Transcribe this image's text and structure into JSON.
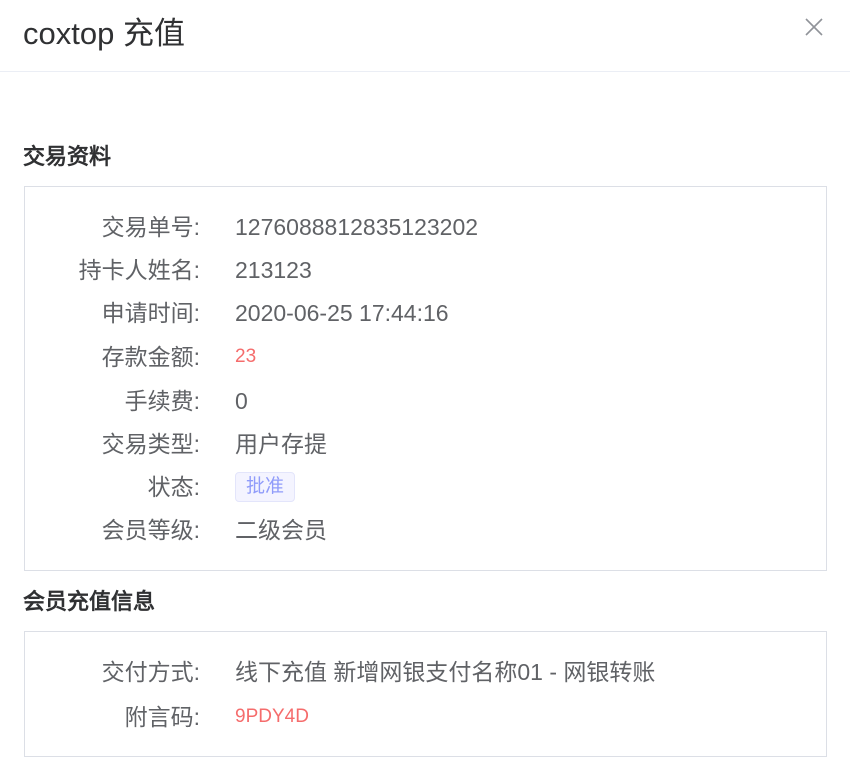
{
  "dialog": {
    "title": "coxtop 充值",
    "close_icon": "close-icon"
  },
  "transaction": {
    "section_title": "交易资料",
    "rows": [
      {
        "label": "交易单号:",
        "value": "1276088812835123202"
      },
      {
        "label": "持卡人姓名:",
        "value": "213123"
      },
      {
        "label": "申请时间:",
        "value": "2020-06-25 17:44:16"
      },
      {
        "label": "存款金额:",
        "value": "23"
      },
      {
        "label": "手续费:",
        "value": "0"
      },
      {
        "label": "交易类型:",
        "value": "用户存提"
      },
      {
        "label": "状态:",
        "value": "批准"
      },
      {
        "label": "会员等级:",
        "value": "二级会员"
      }
    ]
  },
  "member_recharge": {
    "section_title": "会员充值信息",
    "rows": [
      {
        "label": "交付方式:",
        "value": "线下充值 新增网银支付名称01 - 网银转账"
      },
      {
        "label": "附言码:",
        "value": "9PDY4D"
      }
    ]
  },
  "colors": {
    "amount": "#f56c6c",
    "status_tag_text": "#909cfa",
    "status_tag_bg": "#f4f4ff"
  }
}
